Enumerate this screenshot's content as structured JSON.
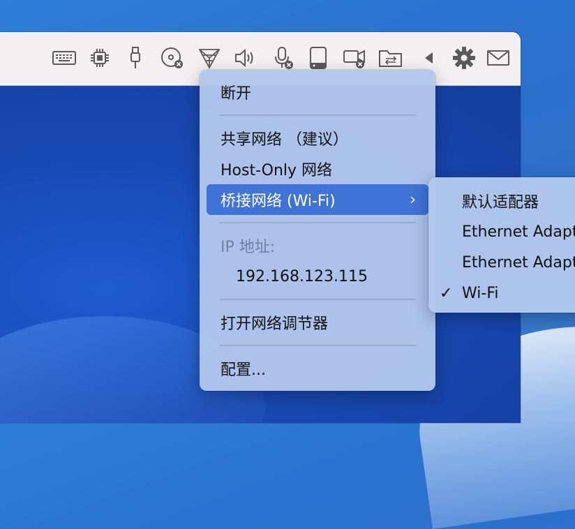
{
  "toolbar": {
    "icons": [
      {
        "name": "keyboard-icon"
      },
      {
        "name": "cpu-icon"
      },
      {
        "name": "usb-icon"
      },
      {
        "name": "cd-disc-disconnected-icon"
      },
      {
        "name": "network-icon"
      },
      {
        "name": "speaker-icon"
      },
      {
        "name": "microphone-disconnected-icon"
      },
      {
        "name": "hard-disk-icon"
      },
      {
        "name": "camera-disconnected-icon"
      },
      {
        "name": "shared-folder-icon"
      },
      {
        "name": "collapse-arrow-icon"
      },
      {
        "name": "settings-gear-icon"
      },
      {
        "name": "mail-icon"
      }
    ]
  },
  "menu": {
    "disconnect": "断开",
    "shared_network": "共享网络 （建议）",
    "host_only": "Host-Only 网络",
    "bridged": "桥接网络 (Wi-Fi)",
    "bridged_chevron": "›",
    "ip_label": "IP 地址:",
    "ip_value": "192.168.123.115",
    "open_conditioner": "打开网络调节器",
    "configure": "配置..."
  },
  "submenu": {
    "items": [
      {
        "label": "默认适配器",
        "checked": false
      },
      {
        "label": "Ethernet Adapter",
        "checked": false
      },
      {
        "label": "Ethernet Adapter",
        "checked": false
      },
      {
        "label": "Wi-Fi",
        "checked": true
      }
    ],
    "checkmark": "✓"
  },
  "colors": {
    "highlight": "#3f73d6",
    "menu_bg": "#b2c7ec",
    "toolbar_bg": "#f4eff0"
  }
}
